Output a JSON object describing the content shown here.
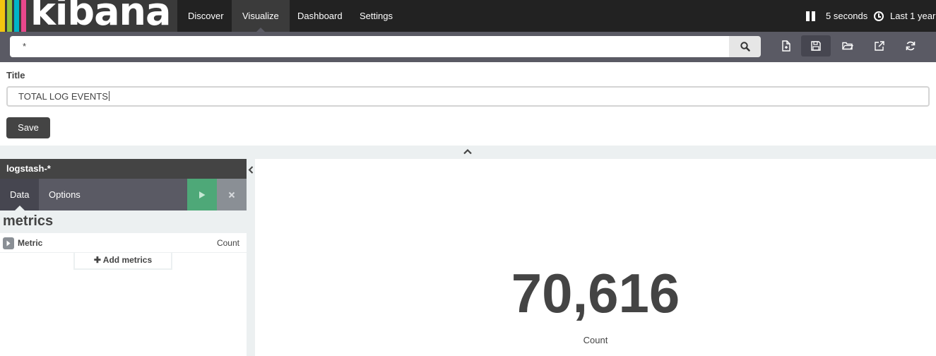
{
  "app": {
    "brand": "kibana"
  },
  "brand_colors": [
    "#f3c510",
    "#8cc63f",
    "#00b4c7",
    "#e8488b"
  ],
  "nav": {
    "items": [
      {
        "label": "Discover",
        "active": false
      },
      {
        "label": "Visualize",
        "active": true
      },
      {
        "label": "Dashboard",
        "active": false
      },
      {
        "label": "Settings",
        "active": false
      }
    ],
    "refresh_interval": "5 seconds",
    "time_range": "Last 1 year"
  },
  "search": {
    "query": "*"
  },
  "toolbar": {
    "icons": [
      "new-document-icon",
      "save-icon",
      "open-folder-icon",
      "share-icon",
      "refresh-icon"
    ],
    "active_index": 1
  },
  "save_form": {
    "title_label": "Title",
    "title_value": "TOTAL LOG EVENTS",
    "save_label": "Save"
  },
  "sidebar": {
    "index_pattern": "logstash-*",
    "tabs": [
      {
        "label": "Data",
        "active": true
      },
      {
        "label": "Options",
        "active": false
      }
    ],
    "section_heading": "metrics",
    "metric": {
      "label": "Metric",
      "aggregation": "Count"
    },
    "add_metrics_label": "Add metrics"
  },
  "visualization": {
    "value": "70,616",
    "label": "Count"
  },
  "colors": {
    "topbar": "#222222",
    "toolbar": "#5a5a64",
    "apply_green": "#4ea878",
    "text_dark": "#444444"
  }
}
